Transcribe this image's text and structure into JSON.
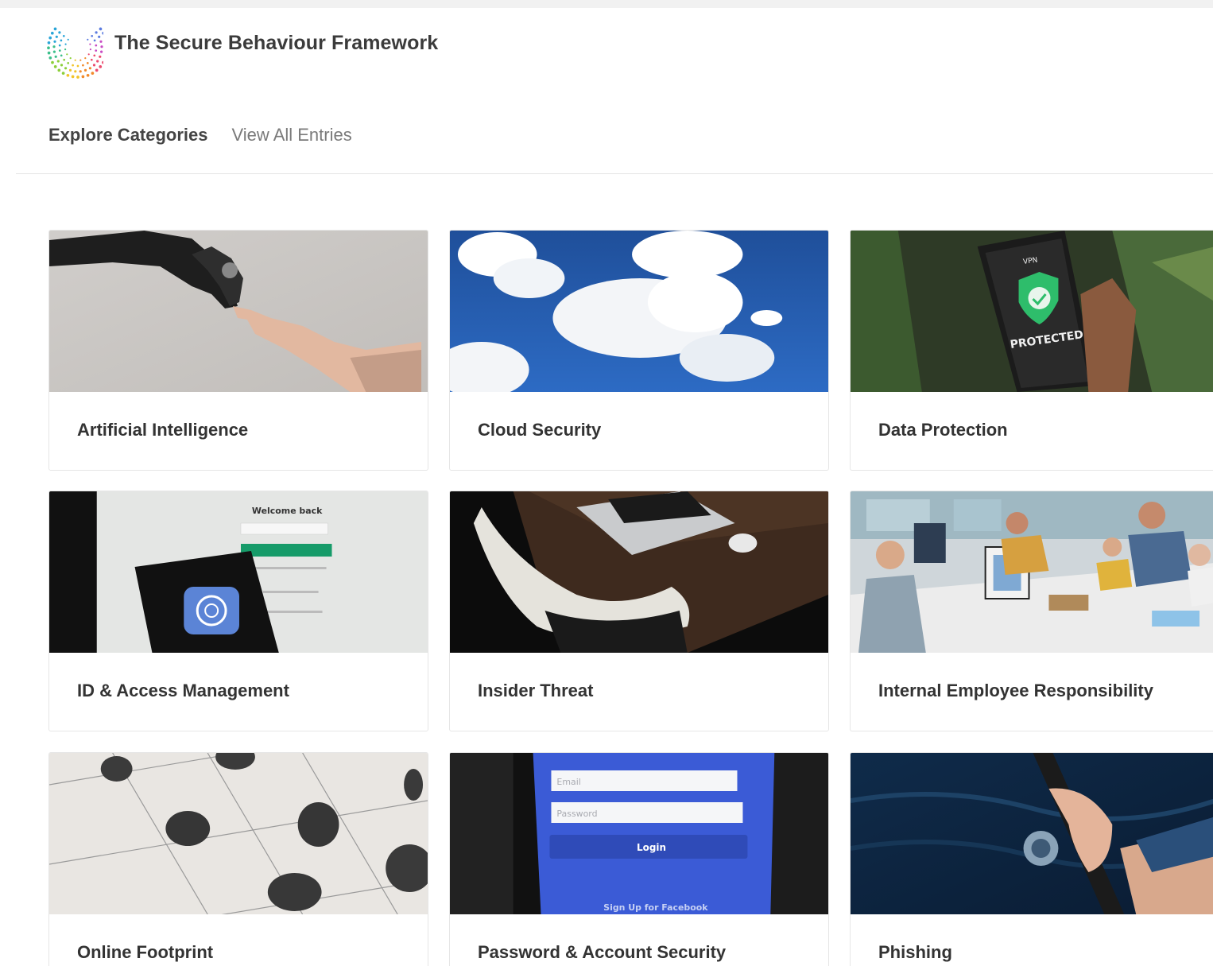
{
  "header": {
    "site_title": "The Secure Behaviour Framework",
    "logo_icon": "dotted-c-logo-icon"
  },
  "nav": {
    "items": [
      {
        "label": "Explore Categories",
        "active": true
      },
      {
        "label": "View All Entries",
        "active": false
      }
    ]
  },
  "categories": [
    {
      "title": "Artificial Intelligence"
    },
    {
      "title": "Cloud Security"
    },
    {
      "title": "Data Protection"
    },
    {
      "title": "ID & Access Management"
    },
    {
      "title": "Insider Threat"
    },
    {
      "title": "Internal Employee Responsibility"
    },
    {
      "title": "Online Footprint"
    },
    {
      "title": "Password & Account Security"
    },
    {
      "title": "Phishing"
    }
  ],
  "image_text": {
    "vpn": "VPN",
    "protected": "PROTECTED",
    "welcome_back": "Welcome back",
    "email_placeholder": "Email",
    "password_placeholder": "Password",
    "login": "Login",
    "signup": "Sign Up for Facebook"
  },
  "colors": {
    "title_text": "#3b3b3b",
    "nav_active": "#444444",
    "nav_inactive": "#7a7a7a",
    "card_border": "#e6e6e6",
    "vpn_green": "#2ebd6b",
    "facebook_blue": "#3b5bd6"
  }
}
